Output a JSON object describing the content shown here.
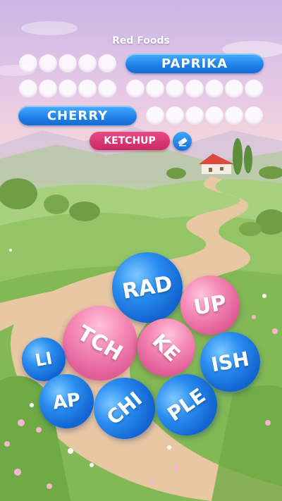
{
  "category": "Red Foods",
  "found_words": {
    "paprika": "PAPRIKA",
    "cherry": "CHERRY"
  },
  "current_word": "KETCHUP",
  "erase_icon": "eraser-icon",
  "letter_bubbles": [
    {
      "id": "rad",
      "text": "RAD",
      "color": "blue"
    },
    {
      "id": "up",
      "text": "UP",
      "color": "pink"
    },
    {
      "id": "tch",
      "text": "TCH",
      "color": "pink"
    },
    {
      "id": "ke",
      "text": "KE",
      "color": "pink"
    },
    {
      "id": "li",
      "text": "LI",
      "color": "blue"
    },
    {
      "id": "ish",
      "text": "ISH",
      "color": "blue"
    },
    {
      "id": "ap",
      "text": "AP",
      "color": "blue"
    },
    {
      "id": "chi",
      "text": "CHI",
      "color": "blue"
    },
    {
      "id": "ple",
      "text": "PLE",
      "color": "blue"
    }
  ]
}
